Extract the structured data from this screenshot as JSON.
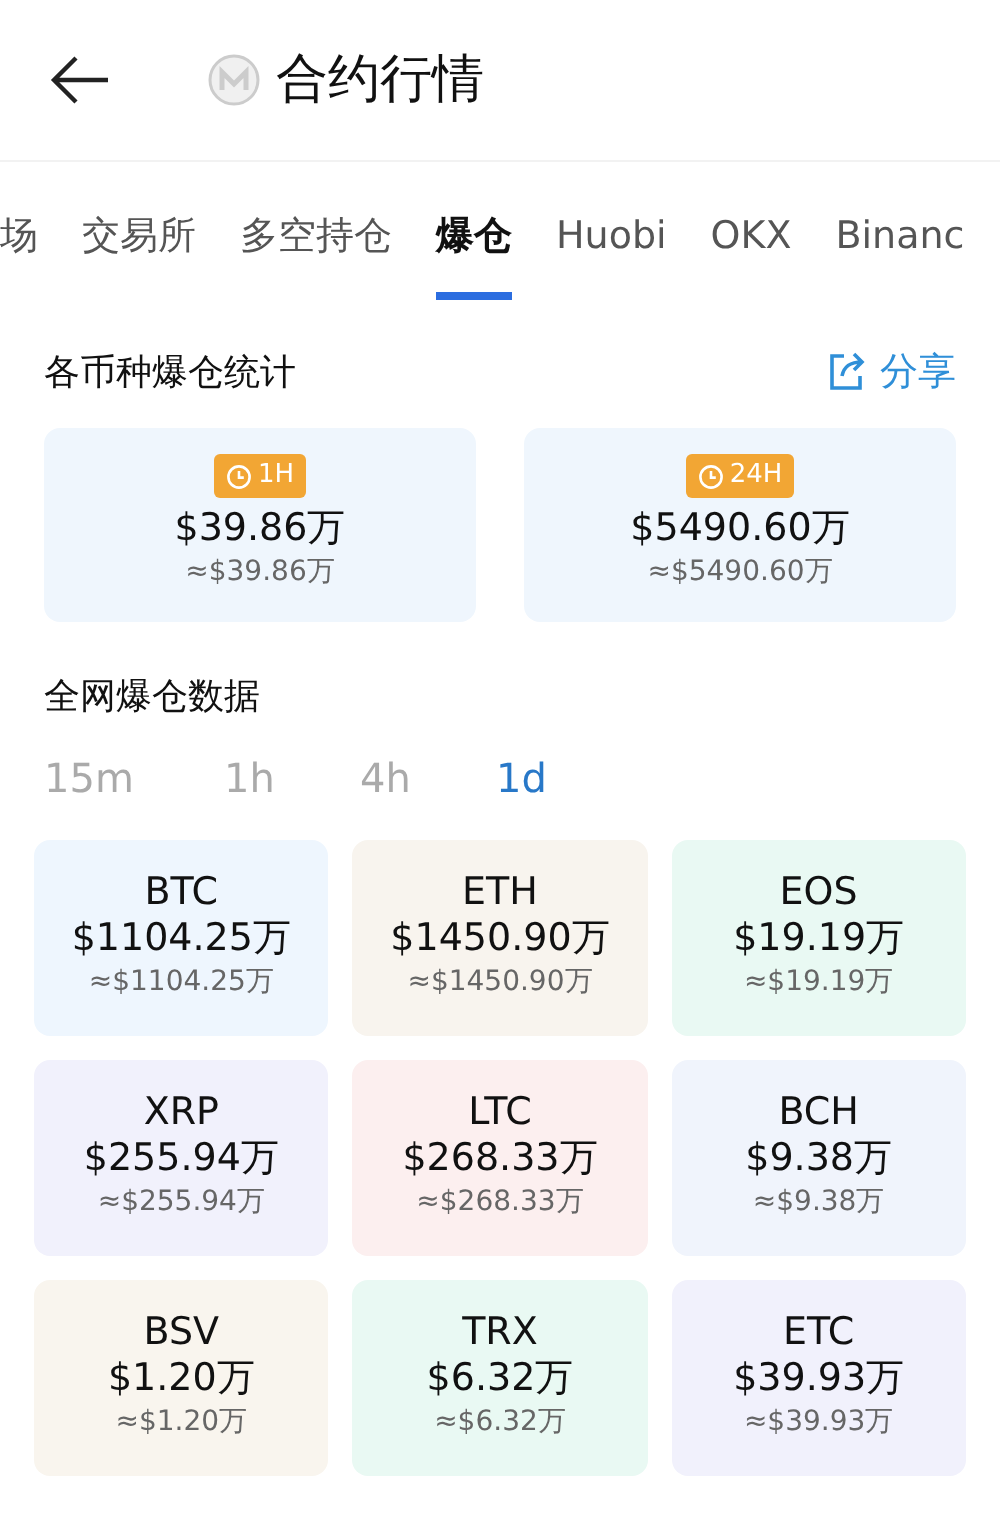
{
  "header": {
    "title": "合约行情"
  },
  "tabs": [
    {
      "label": "场",
      "selected": false
    },
    {
      "label": "交易所",
      "selected": false
    },
    {
      "label": "多空持仓",
      "selected": false
    },
    {
      "label": "爆仓",
      "selected": true
    },
    {
      "label": "Huobi",
      "selected": false
    },
    {
      "label": "OKX",
      "selected": false
    },
    {
      "label": "Binanc",
      "selected": false
    }
  ],
  "stats_section": {
    "title": "各币种爆仓统计",
    "share": "分享",
    "cards": [
      {
        "period": "1H",
        "amount": "$39.86万",
        "approx": "≈$39.86万"
      },
      {
        "period": "24H",
        "amount": "$5490.60万",
        "approx": "≈$5490.60万"
      }
    ]
  },
  "network_section": {
    "title": "全网爆仓数据",
    "intervals": [
      {
        "label": "15m",
        "selected": false
      },
      {
        "label": "1h",
        "selected": false
      },
      {
        "label": "4h",
        "selected": false
      },
      {
        "label": "1d",
        "selected": true
      }
    ],
    "coins": [
      {
        "symbol": "BTC",
        "amount": "$1104.25万",
        "approx": "≈$1104.25万",
        "color": "#eef6fe"
      },
      {
        "symbol": "ETH",
        "amount": "$1450.90万",
        "approx": "≈$1450.90万",
        "color": "#f8f4ee"
      },
      {
        "symbol": "EOS",
        "amount": "$19.19万",
        "approx": "≈$19.19万",
        "color": "#e9f9f3"
      },
      {
        "symbol": "XRP",
        "amount": "$255.94万",
        "approx": "≈$255.94万",
        "color": "#f1f1fc"
      },
      {
        "symbol": "LTC",
        "amount": "$268.33万",
        "approx": "≈$268.33万",
        "color": "#fcefef"
      },
      {
        "symbol": "BCH",
        "amount": "$9.38万",
        "approx": "≈$9.38万",
        "color": "#f0f4fc"
      },
      {
        "symbol": "BSV",
        "amount": "$1.20万",
        "approx": "≈$1.20万",
        "color": "#f9f5ee"
      },
      {
        "symbol": "TRX",
        "amount": "$6.32万",
        "approx": "≈$6.32万",
        "color": "#e9f9f3"
      },
      {
        "symbol": "ETC",
        "amount": "$39.93万",
        "approx": "≈$39.93万",
        "color": "#f1f1fc"
      }
    ]
  }
}
